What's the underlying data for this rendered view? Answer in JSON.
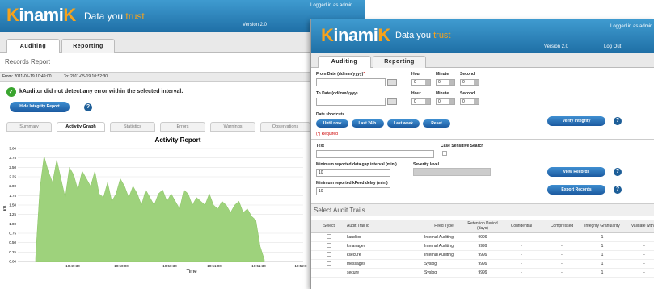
{
  "brand": {
    "name_prefix": "K",
    "name_mid": "inami",
    "name_suffix": "K",
    "tagline_pre": "Data you ",
    "tagline_trust": "trust"
  },
  "win1": {
    "logged_in": "Logged in as admin",
    "version": "Version 2.0",
    "tabs": [
      "Auditing",
      "Reporting"
    ],
    "section_title": "Records Report",
    "date_from": "From: 2011-05-19 10:49:00",
    "date_to": "To: 2011-05-19 10:52:30",
    "status_msg": "kAuditor did not detect any error within the selected interval.",
    "hide_btn": "Hide Integrity Report",
    "subtabs": [
      "Summary",
      "Activity Graph",
      "Statistics",
      "Errors",
      "Warnings",
      "Observations"
    ],
    "chart": {
      "title": "Activity Report",
      "ylabel": "KB",
      "xlabel": "Time",
      "yticks": [
        "3.00",
        "2.75",
        "2.50",
        "2.25",
        "2.00",
        "1.75",
        "1.50",
        "1.25",
        "1.00",
        "0.75",
        "0.50",
        "0.25",
        "0.00"
      ],
      "xticks": [
        "10:49:30",
        "10:50:00",
        "10:50:30",
        "10:51:00",
        "10:51:30",
        "10:52:0"
      ]
    }
  },
  "chart_data": {
    "type": "area",
    "title": "Activity Report",
    "xlabel": "Time",
    "ylabel": "KB",
    "ylim": [
      0,
      3.0
    ],
    "color": "#9ed27c",
    "x": [
      "10:49:07",
      "10:49:10",
      "10:49:13",
      "10:49:16",
      "10:49:19",
      "10:49:22",
      "10:49:25",
      "10:49:28",
      "10:49:31",
      "10:49:34",
      "10:49:37",
      "10:49:40",
      "10:49:43",
      "10:49:46",
      "10:49:49",
      "10:49:52",
      "10:49:55",
      "10:49:58",
      "10:50:01",
      "10:50:04",
      "10:50:07",
      "10:50:10",
      "10:50:13",
      "10:50:16",
      "10:50:19",
      "10:50:22",
      "10:50:25",
      "10:50:28",
      "10:50:31",
      "10:50:34",
      "10:50:37",
      "10:50:40",
      "10:50:43",
      "10:50:46",
      "10:50:49",
      "10:50:52",
      "10:50:55",
      "10:50:58",
      "10:51:01",
      "10:51:04",
      "10:51:07",
      "10:51:10",
      "10:51:13",
      "10:51:16",
      "10:51:19",
      "10:51:22",
      "10:51:25",
      "10:51:28",
      "10:51:31",
      "10:51:34",
      "10:51:37",
      "10:51:40",
      "10:51:43",
      "10:51:46",
      "10:51:49"
    ],
    "values": [
      0.1,
      1.9,
      2.8,
      2.4,
      2.1,
      2.7,
      2.2,
      1.7,
      2.5,
      2.3,
      1.9,
      2.4,
      2.2,
      2.0,
      2.4,
      1.8,
      1.7,
      2.1,
      1.6,
      1.8,
      2.2,
      2.0,
      1.7,
      2.0,
      1.8,
      1.5,
      1.9,
      1.7,
      1.5,
      1.8,
      1.9,
      1.6,
      1.8,
      1.6,
      1.4,
      1.9,
      1.8,
      1.5,
      1.7,
      1.6,
      1.5,
      1.8,
      1.5,
      1.4,
      1.6,
      1.5,
      1.3,
      1.5,
      1.6,
      1.3,
      1.4,
      1.2,
      1.1,
      0.4,
      0.05
    ]
  },
  "win2": {
    "logged_in": "Logged in as admin",
    "version": "Version 2.0",
    "logout": "Log Out",
    "tabs": [
      "Auditing",
      "Reporting"
    ],
    "from_date_label": "From Date (dd/mm/yyyy)",
    "required_star": "*",
    "to_date_label": "To Date (dd/mm/yyyy)",
    "hour_label": "Hour",
    "minute_label": "Minute",
    "second_label": "Second",
    "zero": "0",
    "shortcuts_label": "Date shortcuts",
    "shortcuts": [
      "Until now",
      "Last 24 h.",
      "Last week",
      "Reset"
    ],
    "required_note": "(*) Required",
    "verify_btn": "Verify Integrity",
    "text_label": "Text",
    "case_label": "Case Sensitive Search",
    "gap_label": "Minimum reported data gap interval (min.)",
    "gap_value": "10",
    "severity_label": "Severity level",
    "delay_label": "Minimum reported kFeed delay (min.)",
    "delay_value": "10",
    "view_btn": "View Records",
    "export_btn": "Export Records",
    "select_title": "Select Audit Trails",
    "cols": [
      "Select",
      "Audit Trail Id",
      "Feed Type",
      "Retention Period (days)",
      "Confidential",
      "Compressed",
      "Integrity Granularity",
      "Validate with T"
    ],
    "rows": [
      {
        "id": "kauditor",
        "feed": "Internal Auditing",
        "ret": "9999",
        "conf": "-",
        "comp": "-",
        "gran": "1",
        "val": "-"
      },
      {
        "id": "kmanager",
        "feed": "Internal Auditing",
        "ret": "9999",
        "conf": "-",
        "comp": "-",
        "gran": "1",
        "val": "-"
      },
      {
        "id": "ksecure",
        "feed": "Internal Auditing",
        "ret": "9999",
        "conf": "-",
        "comp": "-",
        "gran": "1",
        "val": "-"
      },
      {
        "id": "messages",
        "feed": "Syslog",
        "ret": "9999",
        "conf": "-",
        "comp": "-",
        "gran": "1",
        "val": "-"
      },
      {
        "id": "secure",
        "feed": "Syslog",
        "ret": "9999",
        "conf": "-",
        "comp": "-",
        "gran": "1",
        "val": "-"
      }
    ]
  }
}
